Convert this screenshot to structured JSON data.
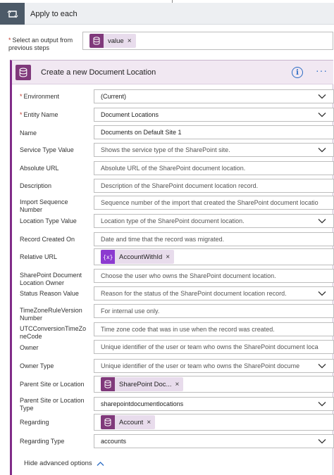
{
  "loop": {
    "title": "Apply to each",
    "select_label": "Select an output from previous steps",
    "select_token": "value"
  },
  "action": {
    "title": "Create a new Document Location",
    "fields": {
      "environment": {
        "label": "Environment",
        "required": "*",
        "value": "(Current)"
      },
      "entity_name": {
        "label": "Entity Name",
        "required": "*",
        "value": "Document Locations"
      },
      "name": {
        "label": "Name",
        "value": "Documents on Default Site 1"
      },
      "service_type": {
        "label": "Service Type Value",
        "placeholder": "Shows the service type of the SharePoint site."
      },
      "absolute_url": {
        "label": "Absolute URL",
        "placeholder": "Absolute URL of the SharePoint document location."
      },
      "description": {
        "label": "Description",
        "placeholder": "Description of the SharePoint document location record."
      },
      "import_seq": {
        "label": "Import Sequence Number",
        "placeholder": "Sequence number of the import that created the SharePoint document locatio"
      },
      "location_type": {
        "label": "Location Type Value",
        "placeholder": "Location type of the SharePoint document location."
      },
      "record_created": {
        "label": "Record Created On",
        "placeholder": "Date and time that the record was migrated."
      },
      "relative_url": {
        "label": "Relative URL",
        "token": "AccountWithId"
      },
      "sp_owner": {
        "label": "SharePoint Document Location Owner",
        "placeholder": "Choose the user who owns the SharePoint document location."
      },
      "status_reason": {
        "label": "Status Reason Value",
        "placeholder": "Reason for the status of the SharePoint document location record."
      },
      "tz_rule": {
        "label": "TimeZoneRuleVersion Number",
        "placeholder": "For internal use only."
      },
      "utc_tz": {
        "label": "UTCConversionTimeZoneCode",
        "placeholder": "Time zone code that was in use when the record was created."
      },
      "owner": {
        "label": "Owner",
        "placeholder": "Unique identifier of the user or team who owns the SharePoint document loca"
      },
      "owner_type": {
        "label": "Owner Type",
        "placeholder": "Unique identifier of the user or team who owns the SharePoint docume"
      },
      "parent_site": {
        "label": "Parent Site or Location",
        "token": "SharePoint Doc..."
      },
      "parent_site_type": {
        "label": "Parent Site or Location Type",
        "value": "sharepointdocumentlocations"
      },
      "regarding": {
        "label": "Regarding",
        "token": "Account"
      },
      "regarding_type": {
        "label": "Regarding Type",
        "value": "accounts"
      }
    },
    "advanced_toggle": "Hide advanced options"
  },
  "colors": {
    "accent_purple": "#802c88",
    "loop_icon_bg": "#4c5a68",
    "info_blue": "#2b6cc4",
    "expression_token": "#8c3ad0"
  }
}
